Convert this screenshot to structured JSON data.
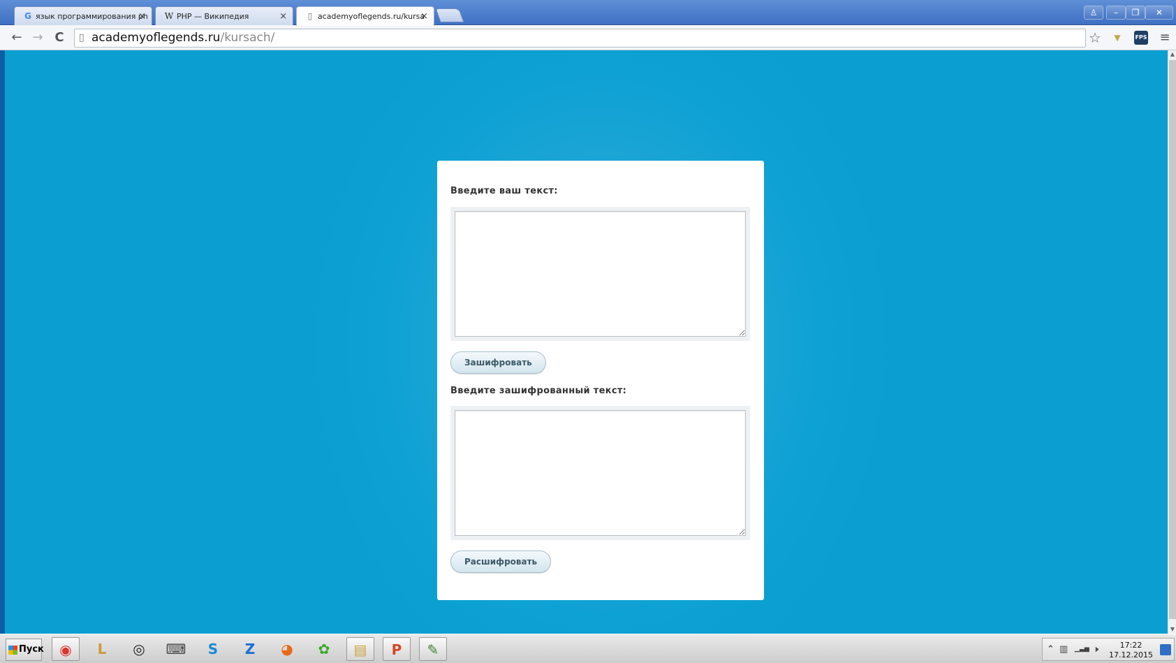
{
  "browser": {
    "tabs": [
      {
        "icon": "google-icon",
        "glyph": "G",
        "label": "язык программирования ph",
        "active": false
      },
      {
        "icon": "wikipedia-icon",
        "glyph": "W",
        "label": "PHP — Википедия",
        "active": false
      },
      {
        "icon": "page-icon",
        "glyph": "▯",
        "label": "academyoflegends.ru/kursa",
        "active": true
      }
    ],
    "close_glyph": "×",
    "url_host": "academyoflegends.ru",
    "url_path": "/kursach/",
    "window_buttons": {
      "user": "♙",
      "minimize": "–",
      "restore": "❐",
      "close": "✕"
    },
    "nav": {
      "back": "←",
      "forward": "→",
      "reload": "C"
    },
    "toolbar_icons": {
      "star": "☆",
      "shield": "▼",
      "fps": "FPS",
      "menu": "≡"
    }
  },
  "form": {
    "label_plain": "Введите ваш текст:",
    "encrypt_button": "Зашифровать",
    "label_cipher": "Введите зашифрованный текст:",
    "decrypt_button": "Расшифровать",
    "plain_value": "",
    "cipher_value": ""
  },
  "taskbar": {
    "start_label": "Пуск",
    "apps": [
      {
        "name": "chrome-icon",
        "glyph": "◉",
        "color": "#d9352a"
      },
      {
        "name": "league-of-legends-icon",
        "glyph": "L",
        "color": "#c89b3c"
      },
      {
        "name": "obs-icon",
        "glyph": "◎",
        "color": "#222222"
      },
      {
        "name": "keyboard-app-icon",
        "glyph": "⌨",
        "color": "#444444"
      },
      {
        "name": "skype-icon",
        "glyph": "S",
        "color": "#1a8ad4"
      },
      {
        "name": "zona-icon",
        "glyph": "Z",
        "color": "#1a6fd4"
      },
      {
        "name": "firefox-icon",
        "glyph": "◕",
        "color": "#e66a17"
      },
      {
        "name": "icq-icon",
        "glyph": "✿",
        "color": "#3aa82a"
      },
      {
        "name": "file-manager-icon",
        "glyph": "▤",
        "color": "#c9a23c"
      },
      {
        "name": "powerpoint-icon",
        "glyph": "P",
        "color": "#d24726"
      },
      {
        "name": "notepad-chart-icon",
        "glyph": "✎",
        "color": "#3b7d2e"
      }
    ],
    "tray": {
      "up": "⌃",
      "net": "▥",
      "signal": "▁▃▅",
      "volume": "🕨",
      "time": "17:22",
      "date": "17.12.2015"
    }
  }
}
